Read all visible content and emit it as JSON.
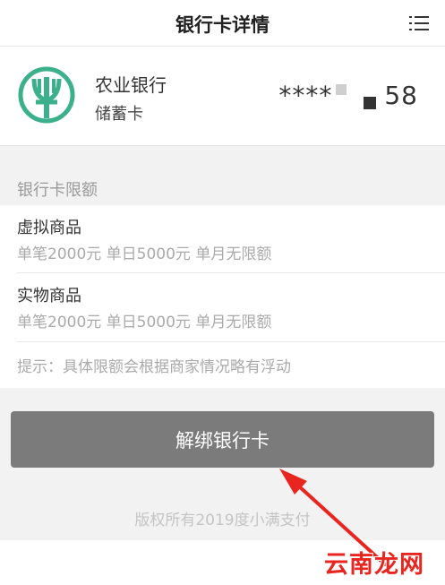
{
  "header": {
    "title": "银行卡详情",
    "menu_icon": "list-menu-icon"
  },
  "card": {
    "bank_name": "农业银行",
    "card_type": "储蓄卡",
    "number_prefix": "****",
    "number_suffix": "58",
    "logo_icon": "abc-bank-logo",
    "logo_color": "#3bb08a"
  },
  "limits": {
    "section_title": "银行卡限额",
    "items": [
      {
        "title": "虚拟商品",
        "detail": "单笔2000元 单日5000元 单月无限额"
      },
      {
        "title": "实物商品",
        "detail": "单笔2000元 单日5000元 单月无限额"
      }
    ],
    "hint": "提示：具体限额会根据商家情况略有浮动"
  },
  "actions": {
    "unbind_label": "解绑银行卡",
    "button_color": "#7b7b7b"
  },
  "footer": {
    "copyright": "版权所有2019度小满支付"
  },
  "overlay": {
    "watermark": "云南龙网",
    "arrow_color": "#e8251f"
  }
}
